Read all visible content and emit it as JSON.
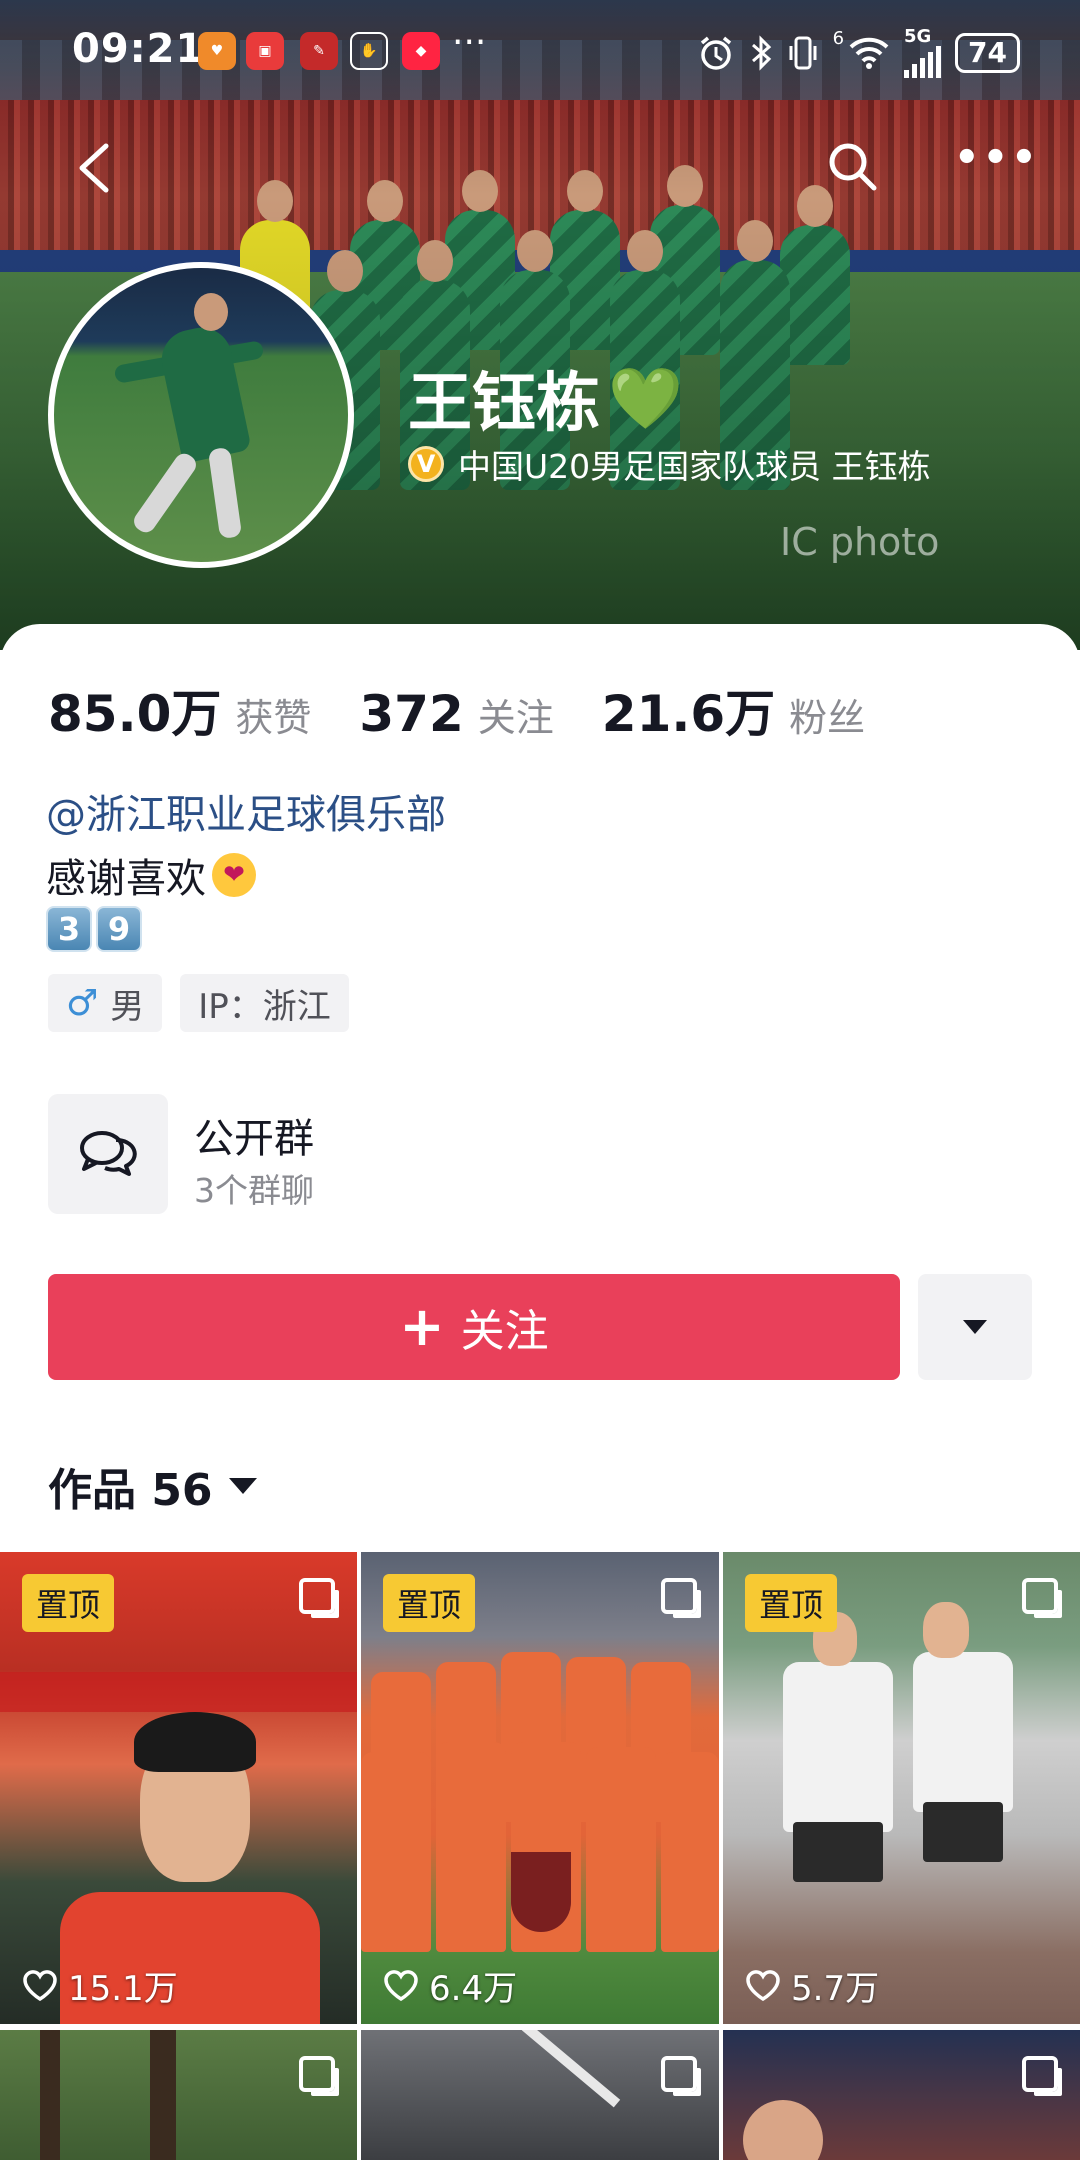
{
  "status_bar": {
    "time": "09:21",
    "network": "5G",
    "signal_sup": "6",
    "battery": "74",
    "overflow": "···"
  },
  "profile": {
    "name": "王钰栋",
    "name_emoji": "💚",
    "verification": "中国U20男足国家队球员 王钰栋",
    "verify_badge": "V",
    "watermark": "IC photo"
  },
  "stats": [
    {
      "value": "85.0万",
      "label": "获赞"
    },
    {
      "value": "372",
      "label": "关注"
    },
    {
      "value": "21.6万",
      "label": "粉丝"
    }
  ],
  "bio": {
    "mention": "@浙江职业足球俱乐部",
    "line1": "感谢喜欢",
    "keycaps": [
      "3",
      "9"
    ]
  },
  "tags": [
    {
      "icon": "male-icon",
      "symbol": "♂",
      "label": "男"
    },
    {
      "label": "IP：浙江"
    }
  ],
  "group": {
    "title": "公开群",
    "subtitle": "3个群聊"
  },
  "actions": {
    "follow_label": "关注",
    "follow_plus": "+"
  },
  "works": {
    "label": "作品 56"
  },
  "grid": [
    {
      "pinned": "置顶",
      "likes": "15.1万"
    },
    {
      "pinned": "置顶",
      "likes": "6.4万"
    },
    {
      "pinned": "置顶",
      "likes": "5.7万"
    }
  ],
  "colors": {
    "follow_button": "#e9405a",
    "pin_badge": "#f7c933",
    "mention": "#2b4f86",
    "verify_badge": "#f3b21e"
  }
}
